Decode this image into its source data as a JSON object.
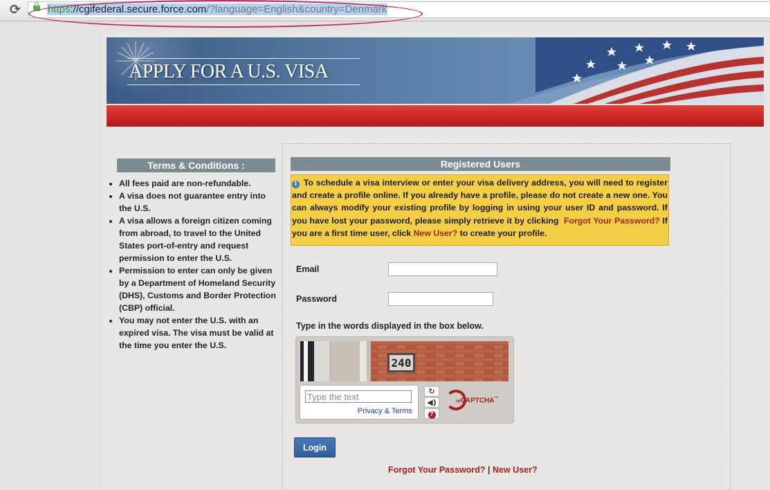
{
  "browser": {
    "reload_icon": "reload-icon",
    "url_scheme": "https",
    "url_scheme_sep": "://",
    "url_host": "cgifederal.secure.force.com",
    "url_path": "/?language=English&country=Denmark"
  },
  "banner": {
    "title": "APPLY FOR A U.S. VISA"
  },
  "terms": {
    "heading": "Terms & Conditions :",
    "items": [
      "All fees paid are non-refundable.",
      "A visa does not guarantee entry into the U.S.",
      "A visa allows a foreign citizen coming from abroad, to travel to the United States port-of-entry and request permission to enter the U.S.",
      "Permission to enter can only be given by a Department of Homeland Security (DHS), Customs and Border Protection (CBP) official.",
      "You may not enter the U.S. with an expired visa. The visa must be valid at the time you enter the U.S."
    ]
  },
  "registered": {
    "heading": "Registered Users",
    "notice_text_1": "To schedule a visa interview or enter your visa delivery address, you will need to register and create a profile online. If you already have a profile, please do not create a new one. You can always modify your existing profile by logging in using your user ID and password. If you have lost your password, please simply retrieve it by clicking",
    "notice_link_forgot": "Forgot Your Password?",
    "notice_text_2": "If you are a first time user, click",
    "notice_link_new": "New User?",
    "notice_text_3": "to create your profile.",
    "email_label": "Email",
    "email_value": "",
    "password_label": "Password",
    "password_value": "",
    "captcha_instruction": "Type in the words displayed in the box below.",
    "captcha_image_text": "240",
    "captcha_placeholder": "Type the text",
    "captcha_privacy": "Privacy & Terms",
    "captcha_brand_prefix": "re",
    "captcha_brand": "CAPTCHA",
    "captcha_tm": "™",
    "login_label": "Login",
    "forgot_link": "Forgot Your Password?",
    "separator": "|",
    "new_user_link": "New User?"
  },
  "colors": {
    "header_bar": "#7a8c92",
    "notice_bg": "#f4cf45",
    "link_red": "#a8201c",
    "login_blue": "#2e5f9c",
    "banner_red": "#c92522"
  }
}
